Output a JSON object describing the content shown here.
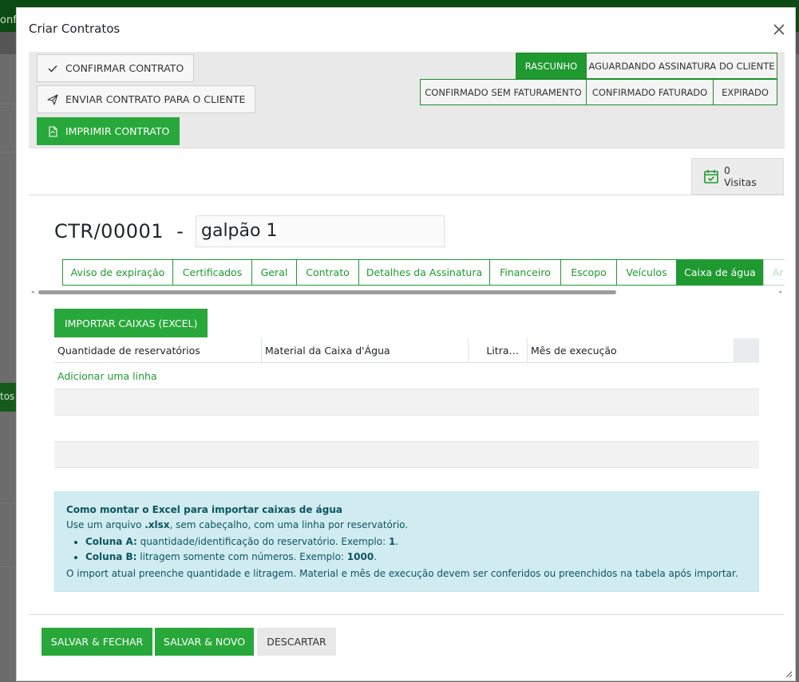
{
  "background": {
    "left_text_top": "onfi",
    "left_text_mid": "tos"
  },
  "modal": {
    "title": "Criar Contratos"
  },
  "actions": {
    "confirm": "CONFIRMAR CONTRATO",
    "send": "ENVIAR CONTRATO PARA O CLIENTE",
    "print": "IMPRIMIR CONTRATO"
  },
  "status": {
    "draft": "RASCUNHO",
    "awaiting": "AGUARDANDO ASSINATURA DO CLIENTE",
    "confirmed_no_billing": "CONFIRMADO SEM FATURAMENTO",
    "confirmed_billed": "CONFIRMADO FATURADO",
    "expired": "EXPIRADO",
    "active": "RASCUNHO"
  },
  "visits": {
    "count": "0",
    "label": "Visitas"
  },
  "record": {
    "reference": "CTR/00001",
    "separator": "-",
    "name": "galpão 1"
  },
  "tabs": [
    {
      "label": "Aviso de expiração"
    },
    {
      "label": "Certificados"
    },
    {
      "label": "Geral"
    },
    {
      "label": "Contrato"
    },
    {
      "label": "Detalhes da Assinatura"
    },
    {
      "label": "Financeiro"
    },
    {
      "label": "Escopo"
    },
    {
      "label": "Veículos"
    },
    {
      "label": "Caixa de água"
    },
    {
      "label": "Ar"
    }
  ],
  "active_tab": "Caixa de água",
  "water_tank": {
    "import_button": "IMPORTAR CAIXAS (EXCEL)",
    "columns": [
      "Quantidade de reservatórios",
      "Material da Caixa d'Água",
      "Litra…",
      "Mês de execução"
    ],
    "add_line": "Adicionar uma linha"
  },
  "info": {
    "heading": "Como montar o Excel para importar caixas de água",
    "intro_pre": "Use um arquivo ",
    "intro_ext": ".xlsx",
    "intro_post": ", sem cabeçalho, com uma linha por reservatório.",
    "col_a_label": "Coluna A:",
    "col_a_text": " quantidade/identificação do reservatório. Exemplo: ",
    "col_a_example": "1",
    "col_b_label": "Coluna B:",
    "col_b_text": " litragem somente com números. Exemplo: ",
    "col_b_example": "1000",
    "footer": "O import atual preenche quantidade e litragem. Material e mês de execução devem ser conferidos ou preenchidos na tabela após importar."
  },
  "footer": {
    "save_close": "SALVAR & FECHAR",
    "save_new": "SALVAR & NOVO",
    "discard": "DESCARTAR"
  },
  "colors": {
    "accent": "#28a83a",
    "info_bg": "#d1ecf1"
  }
}
